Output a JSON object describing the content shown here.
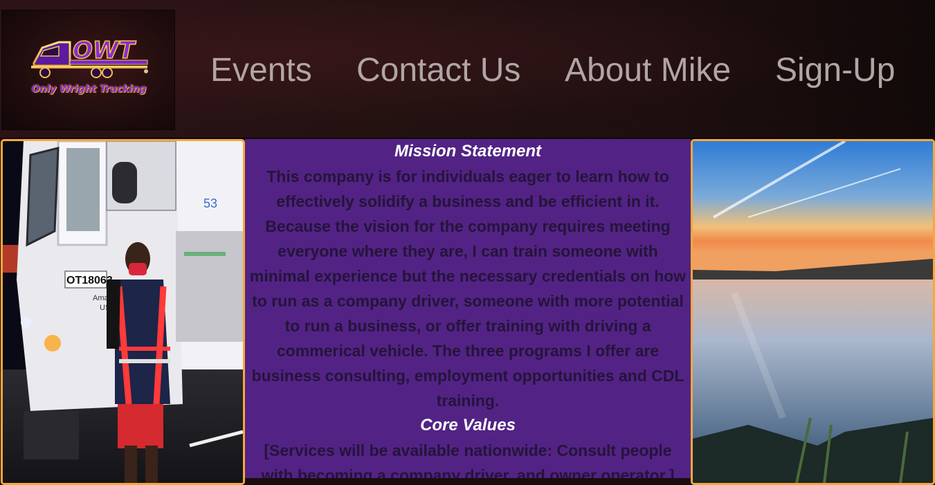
{
  "header": {
    "logo": {
      "letters": "OWT",
      "tagline": "Only Wright Trucking"
    },
    "nav": [
      {
        "label": "Events"
      },
      {
        "label": "Contact Us"
      },
      {
        "label": "About Mike"
      },
      {
        "label": "Sign-Up"
      }
    ]
  },
  "left_photo": {
    "truck_number": "OT18063",
    "truck_text_1": "Amazon Lo",
    "truck_text_2": "USDOT",
    "side_number": "53"
  },
  "main": {
    "mission_heading": "Mission Statement",
    "mission_text": "This company is for individuals eager to learn how to effectively solidify a business and be efficient in it. Because the vision for the company requires meeting everyone where they are, I can train someone with minimal experience but the necessary credentials on how to run as a company driver, someone with more potential to run a business, or offer training with driving a commerical vehicle. The three programs I offer are business consulting, employment opportunities and CDL training.",
    "core_heading": "Core Values",
    "core_text": "[Services will be available nationwide: Consult people with becoming a company driver, and owner operator.]"
  },
  "colors": {
    "center_bg": "#522384",
    "body_text": "#25143a",
    "heading_text": "#ffffff",
    "panel_border": "#f4a93a",
    "nav_text": "#b1a5a5"
  }
}
